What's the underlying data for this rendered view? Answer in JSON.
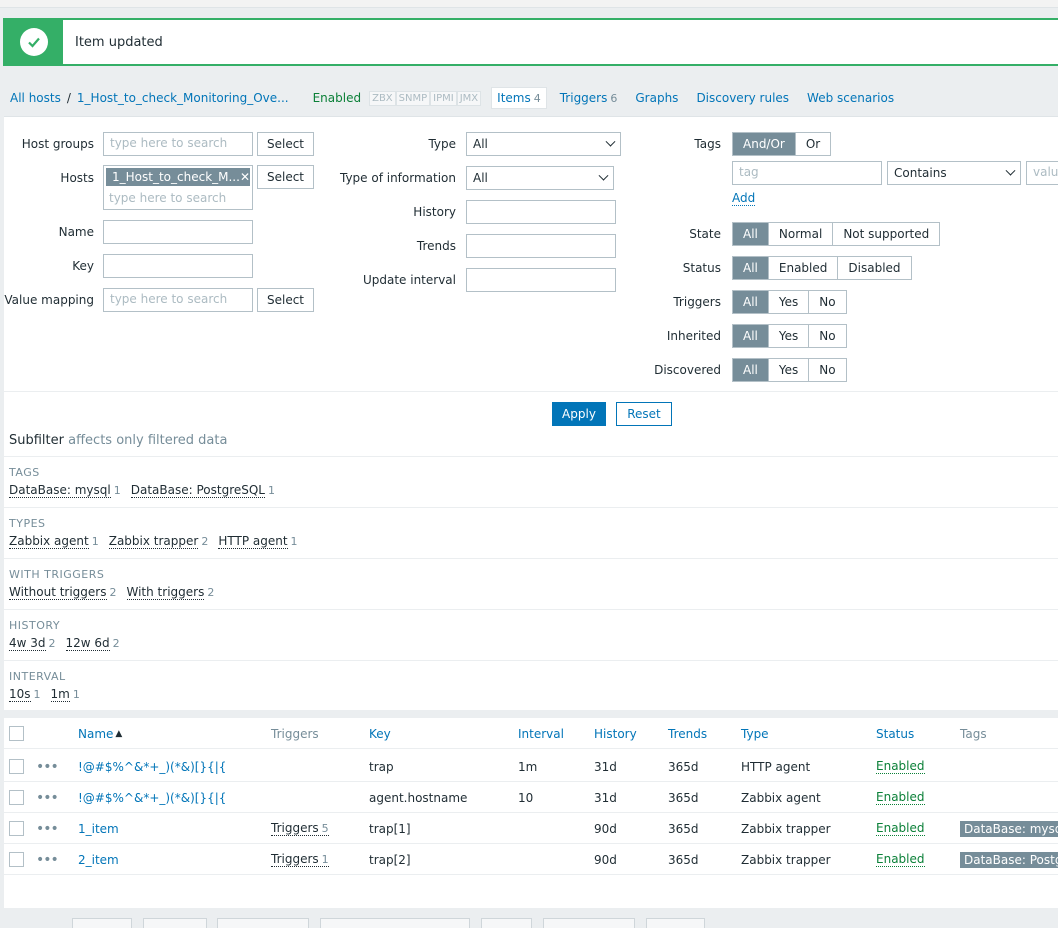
{
  "message": {
    "text": "Item updated",
    "icon": "check-icon"
  },
  "host_nav": {
    "all_hosts": "All hosts",
    "separator": "/",
    "host_name": "1_Host_to_check_Monitoring_Ove...",
    "status": "Enabled",
    "availability": [
      "ZBX",
      "SNMP",
      "IPMI",
      "JMX"
    ],
    "tabs": [
      {
        "label": "Items",
        "count": "4",
        "active": true
      },
      {
        "label": "Triggers",
        "count": "6"
      },
      {
        "label": "Graphs",
        "count": ""
      },
      {
        "label": "Discovery rules",
        "count": ""
      },
      {
        "label": "Web scenarios",
        "count": ""
      }
    ]
  },
  "filter": {
    "host_groups": {
      "label": "Host groups",
      "placeholder": "type here to search",
      "button": "Select"
    },
    "hosts": {
      "label": "Hosts",
      "chip": "1_Host_to_check_M...",
      "placeholder": "type here to search",
      "button": "Select"
    },
    "name": {
      "label": "Name",
      "value": ""
    },
    "key": {
      "label": "Key",
      "value": ""
    },
    "value_mapping": {
      "label": "Value mapping",
      "placeholder": "type here to search",
      "button": "Select"
    },
    "type": {
      "label": "Type",
      "value": "All"
    },
    "type_of_information": {
      "label": "Type of information",
      "value": "All"
    },
    "history": {
      "label": "History",
      "value": ""
    },
    "trends": {
      "label": "Trends",
      "value": ""
    },
    "update_interval": {
      "label": "Update interval",
      "value": ""
    },
    "tags": {
      "label": "Tags",
      "options": [
        "And/Or",
        "Or"
      ],
      "tag_placeholder": "tag",
      "operator": "Contains",
      "value_placeholder": "value",
      "add": "Add"
    },
    "state": {
      "label": "State",
      "options": [
        "All",
        "Normal",
        "Not supported"
      ]
    },
    "status": {
      "label": "Status",
      "options": [
        "All",
        "Enabled",
        "Disabled"
      ]
    },
    "triggers": {
      "label": "Triggers",
      "options": [
        "All",
        "Yes",
        "No"
      ]
    },
    "inherited": {
      "label": "Inherited",
      "options": [
        "All",
        "Yes",
        "No"
      ]
    },
    "discovered": {
      "label": "Discovered",
      "options": [
        "All",
        "Yes",
        "No"
      ]
    },
    "apply": "Apply",
    "reset": "Reset"
  },
  "subfilter": {
    "title": "Subfilter",
    "hint": "affects only filtered data",
    "sections": [
      {
        "heading": "TAGS",
        "items": [
          {
            "label": "DataBase: mysql",
            "count": "1"
          },
          {
            "label": "DataBase: PostgreSQL",
            "count": "1"
          }
        ]
      },
      {
        "heading": "TYPES",
        "items": [
          {
            "label": "Zabbix agent",
            "count": "1"
          },
          {
            "label": "Zabbix trapper",
            "count": "2"
          },
          {
            "label": "HTTP agent",
            "count": "1"
          }
        ]
      },
      {
        "heading": "WITH TRIGGERS",
        "items": [
          {
            "label": "Without triggers",
            "count": "2"
          },
          {
            "label": "With triggers",
            "count": "2"
          }
        ]
      },
      {
        "heading": "HISTORY",
        "items": [
          {
            "label": "4w 3d",
            "count": "2"
          },
          {
            "label": "12w 6d",
            "count": "2"
          }
        ]
      },
      {
        "heading": "INTERVAL",
        "items": [
          {
            "label": "10s",
            "count": "1"
          },
          {
            "label": "1m",
            "count": "1"
          }
        ]
      }
    ]
  },
  "table": {
    "headers": {
      "name": "Name",
      "sort_arrow": "▲",
      "triggers": "Triggers",
      "key": "Key",
      "interval": "Interval",
      "history": "History",
      "trends": "Trends",
      "type": "Type",
      "status": "Status",
      "tags": "Tags"
    },
    "rows": [
      {
        "name": "!@#$%^&*+_)(*&)[}{|{",
        "triggers": "",
        "trig_count": "",
        "key": "trap",
        "interval": "1m",
        "history": "31d",
        "trends": "365d",
        "type": "HTTP agent",
        "status": "Enabled",
        "tag": ""
      },
      {
        "name": "!@#$%^&*+_)(*&)[}{|{",
        "triggers": "",
        "trig_count": "",
        "key": "agent.hostname",
        "interval": "10",
        "history": "31d",
        "trends": "365d",
        "type": "Zabbix agent",
        "status": "Enabled",
        "tag": ""
      },
      {
        "name": "1_item",
        "triggers": "Triggers",
        "trig_count": "5",
        "key": "trap[1]",
        "interval": "",
        "history": "90d",
        "trends": "365d",
        "type": "Zabbix trapper",
        "status": "Enabled",
        "tag": "DataBase: mysql"
      },
      {
        "name": "2_item",
        "triggers": "Triggers",
        "trig_count": "1",
        "key": "trap[2]",
        "interval": "",
        "history": "90d",
        "trends": "365d",
        "type": "Zabbix trapper",
        "status": "Enabled",
        "tag": "DataBase: Postgr"
      }
    ]
  }
}
